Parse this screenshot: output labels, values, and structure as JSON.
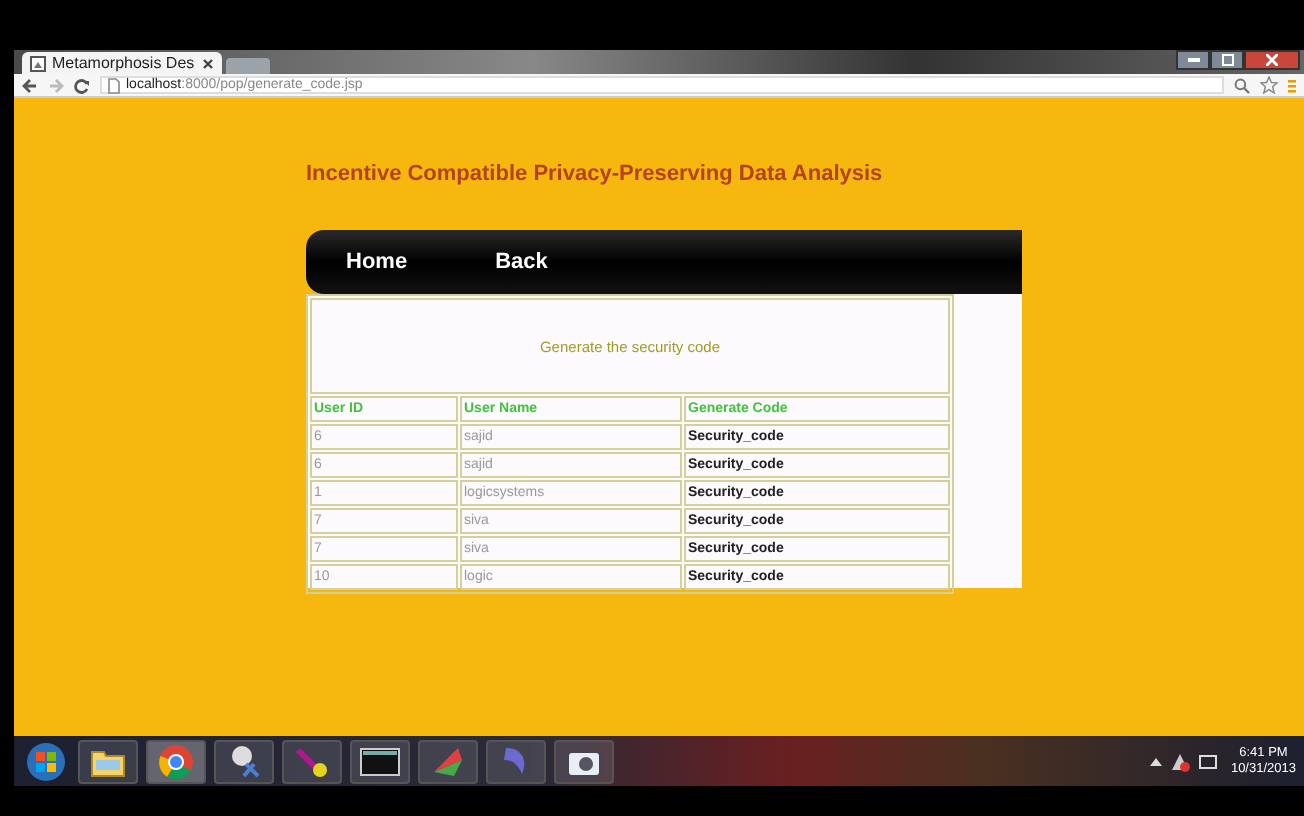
{
  "browser": {
    "tab_title": "Metamorphosis Des",
    "url_host": "localhost",
    "url_rest": ":8000/pop/generate_code.jsp"
  },
  "page": {
    "title": "Incentive Compatible Privacy-Preserving Data Analysis",
    "nav": [
      "Home",
      "Back"
    ],
    "caption": "Generate the security code",
    "table": {
      "columns": [
        "User ID",
        "User Name",
        "Generate Code"
      ],
      "rows": [
        {
          "user_id": "6",
          "user_name": "sajid",
          "code": "Security_code"
        },
        {
          "user_id": "6",
          "user_name": "sajid",
          "code": "Security_code"
        },
        {
          "user_id": "1",
          "user_name": "logicsystems",
          "code": "Security_code"
        },
        {
          "user_id": "7",
          "user_name": "siva",
          "code": "Security_code"
        },
        {
          "user_id": "7",
          "user_name": "siva",
          "code": "Security_code"
        },
        {
          "user_id": "10",
          "user_name": "logic",
          "code": "Security_code"
        }
      ]
    }
  },
  "taskbar": {
    "time": "6:41 PM",
    "date": "10/31/2013"
  }
}
